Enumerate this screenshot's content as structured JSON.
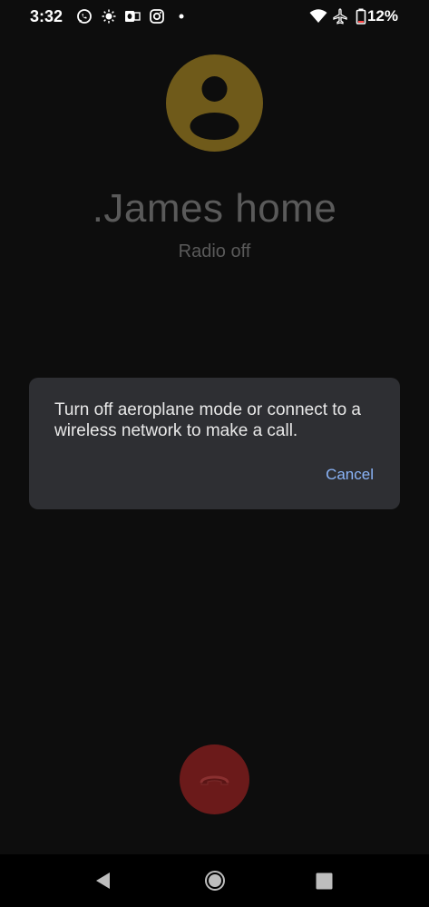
{
  "status_bar": {
    "time": "3:32",
    "notification_icons": [
      "whatsapp-icon",
      "brightness-icon",
      "outlook-icon",
      "instagram-icon",
      "more-dot-icon"
    ],
    "system_icons": [
      "wifi-icon",
      "airplane-icon",
      "battery-icon"
    ],
    "battery": "12%"
  },
  "call": {
    "contact_name": ".James home",
    "status": "Radio off",
    "avatar_color": "#6f5a1a",
    "end_call_color": "#6b1a1a"
  },
  "dialog": {
    "message": "Turn off aeroplane mode or connect to a wireless network to make a call.",
    "cancel_label": "Cancel",
    "accent": "#8ab4f8"
  },
  "nav": {
    "buttons": [
      "back-icon",
      "home-icon",
      "recents-icon"
    ]
  }
}
